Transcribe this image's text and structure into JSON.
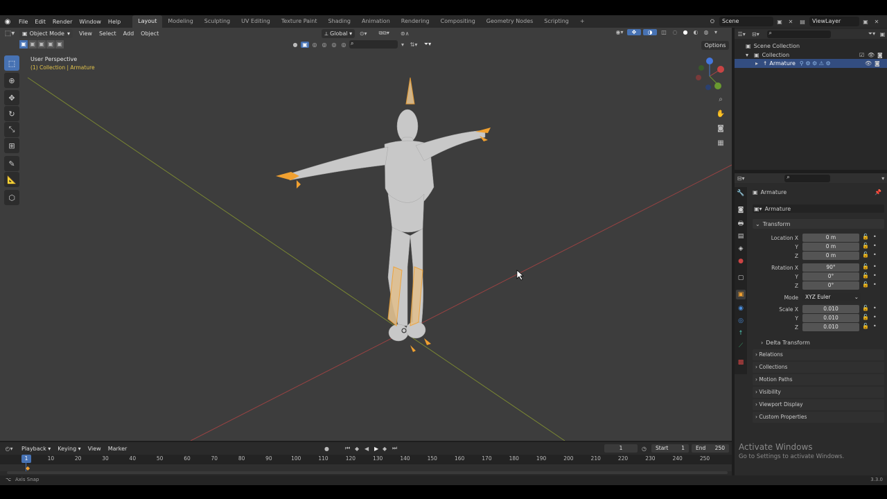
{
  "top_menu": [
    "File",
    "Edit",
    "Render",
    "Window",
    "Help"
  ],
  "workspaces": [
    "Layout",
    "Modeling",
    "Sculpting",
    "UV Editing",
    "Texture Paint",
    "Shading",
    "Animation",
    "Rendering",
    "Compositing",
    "Geometry Nodes",
    "Scripting"
  ],
  "add_workspace": "+",
  "scene": "Scene",
  "view_layer": "ViewLayer",
  "viewport_header": {
    "mode": "Object Mode",
    "menus": [
      "View",
      "Select",
      "Add",
      "Object"
    ],
    "orientation": "Global",
    "options": "Options"
  },
  "viewport": {
    "title": "User Perspective",
    "subtitle": "(1) Collection | Armature",
    "gizmo_axes": [
      "X",
      "Y",
      "Z"
    ]
  },
  "outliner": {
    "root": "Scene Collection",
    "collection": "Collection",
    "object": "Armature"
  },
  "properties": {
    "object_name": "Armature",
    "data_name": "Armature",
    "transform_header": "Transform",
    "location_label": "Location X",
    "rotation_label": "Rotation X",
    "scale_label": "Scale X",
    "y_label": "Y",
    "z_label": "Z",
    "location": [
      "0 m",
      "0 m",
      "0 m"
    ],
    "rotation": [
      "90°",
      "0°",
      "0°"
    ],
    "mode_label": "Mode",
    "mode_value": "XYZ Euler",
    "scale": [
      "0.010",
      "0.010",
      "0.010"
    ],
    "delta_transform": "Delta Transform",
    "panels": [
      "Relations",
      "Collections",
      "Motion Paths",
      "Visibility",
      "Viewport Display",
      "Custom Properties"
    ]
  },
  "timeline": {
    "menus": [
      "Playback",
      "Keying",
      "View",
      "Marker"
    ],
    "current_frame": "1",
    "start_label": "Start",
    "start": "1",
    "end_label": "End",
    "end": "250",
    "ticks": [
      "1",
      "10",
      "20",
      "30",
      "40",
      "50",
      "60",
      "70",
      "80",
      "90",
      "100",
      "110",
      "120",
      "130",
      "140",
      "150",
      "160",
      "170",
      "180",
      "190",
      "200",
      "210",
      "220",
      "230",
      "240",
      "250"
    ]
  },
  "status": {
    "left": "Axis Snap",
    "version": "3.3.0"
  },
  "watermark": {
    "title": "Activate Windows",
    "subtitle": "Go to Settings to activate Windows."
  },
  "colors": {
    "accent": "#4772b3",
    "armature_orange": "#f0a030",
    "x_axis": "#b04444",
    "y_axis": "#8a9a30",
    "viewport_bg": "#3d3d3d"
  }
}
